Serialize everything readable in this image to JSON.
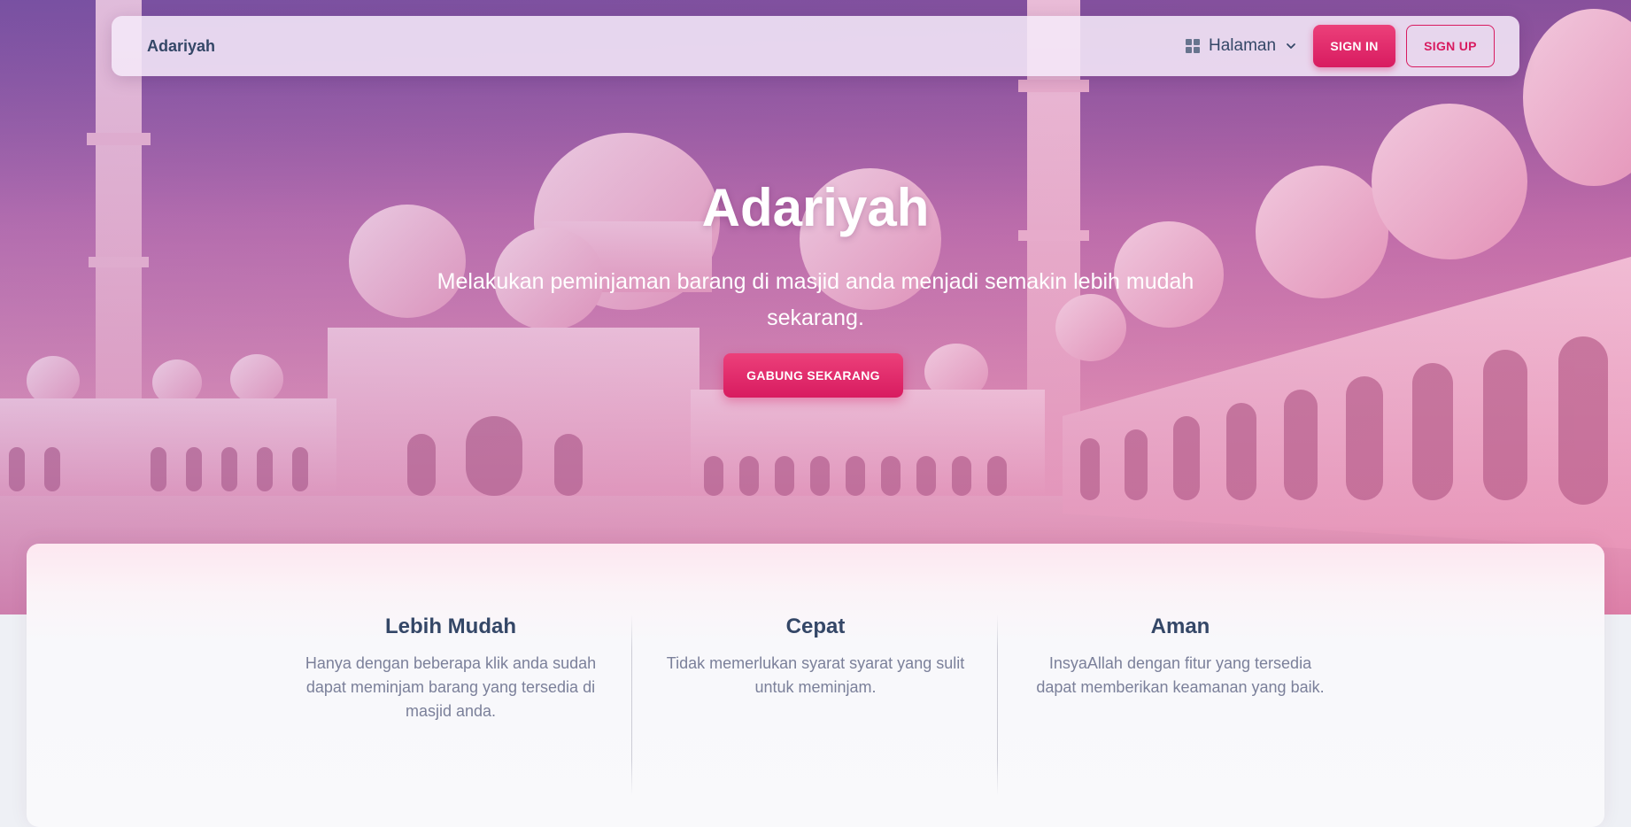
{
  "navbar": {
    "brand": "Adariyah",
    "menu_label": "Halaman",
    "menu_icon": "dashboard-grid-icon",
    "signin_label": "SIGN IN",
    "signup_label": "SIGN UP"
  },
  "hero": {
    "title": "Adariyah",
    "subtitle": "Melakukan peminjaman barang di masjid anda menjadi semakin lebih mudah sekarang.",
    "cta_label": "GABUNG SEKARANG",
    "background": "mosque-photo"
  },
  "features": [
    {
      "title": "Lebih Mudah",
      "text": "Hanya dengan beberapa klik anda sudah dapat meminjam barang yang tersedia di masjid anda."
    },
    {
      "title": "Cepat",
      "text": "Tidak memerlukan syarat syarat yang sulit untuk meminjam."
    },
    {
      "title": "Aman",
      "text": "InsyaAllah dengan fitur yang tersedia dapat memberikan keamanan yang baik."
    }
  ],
  "colors": {
    "primary": "#d81b60",
    "heading": "#344767",
    "muted": "#7b809a"
  }
}
